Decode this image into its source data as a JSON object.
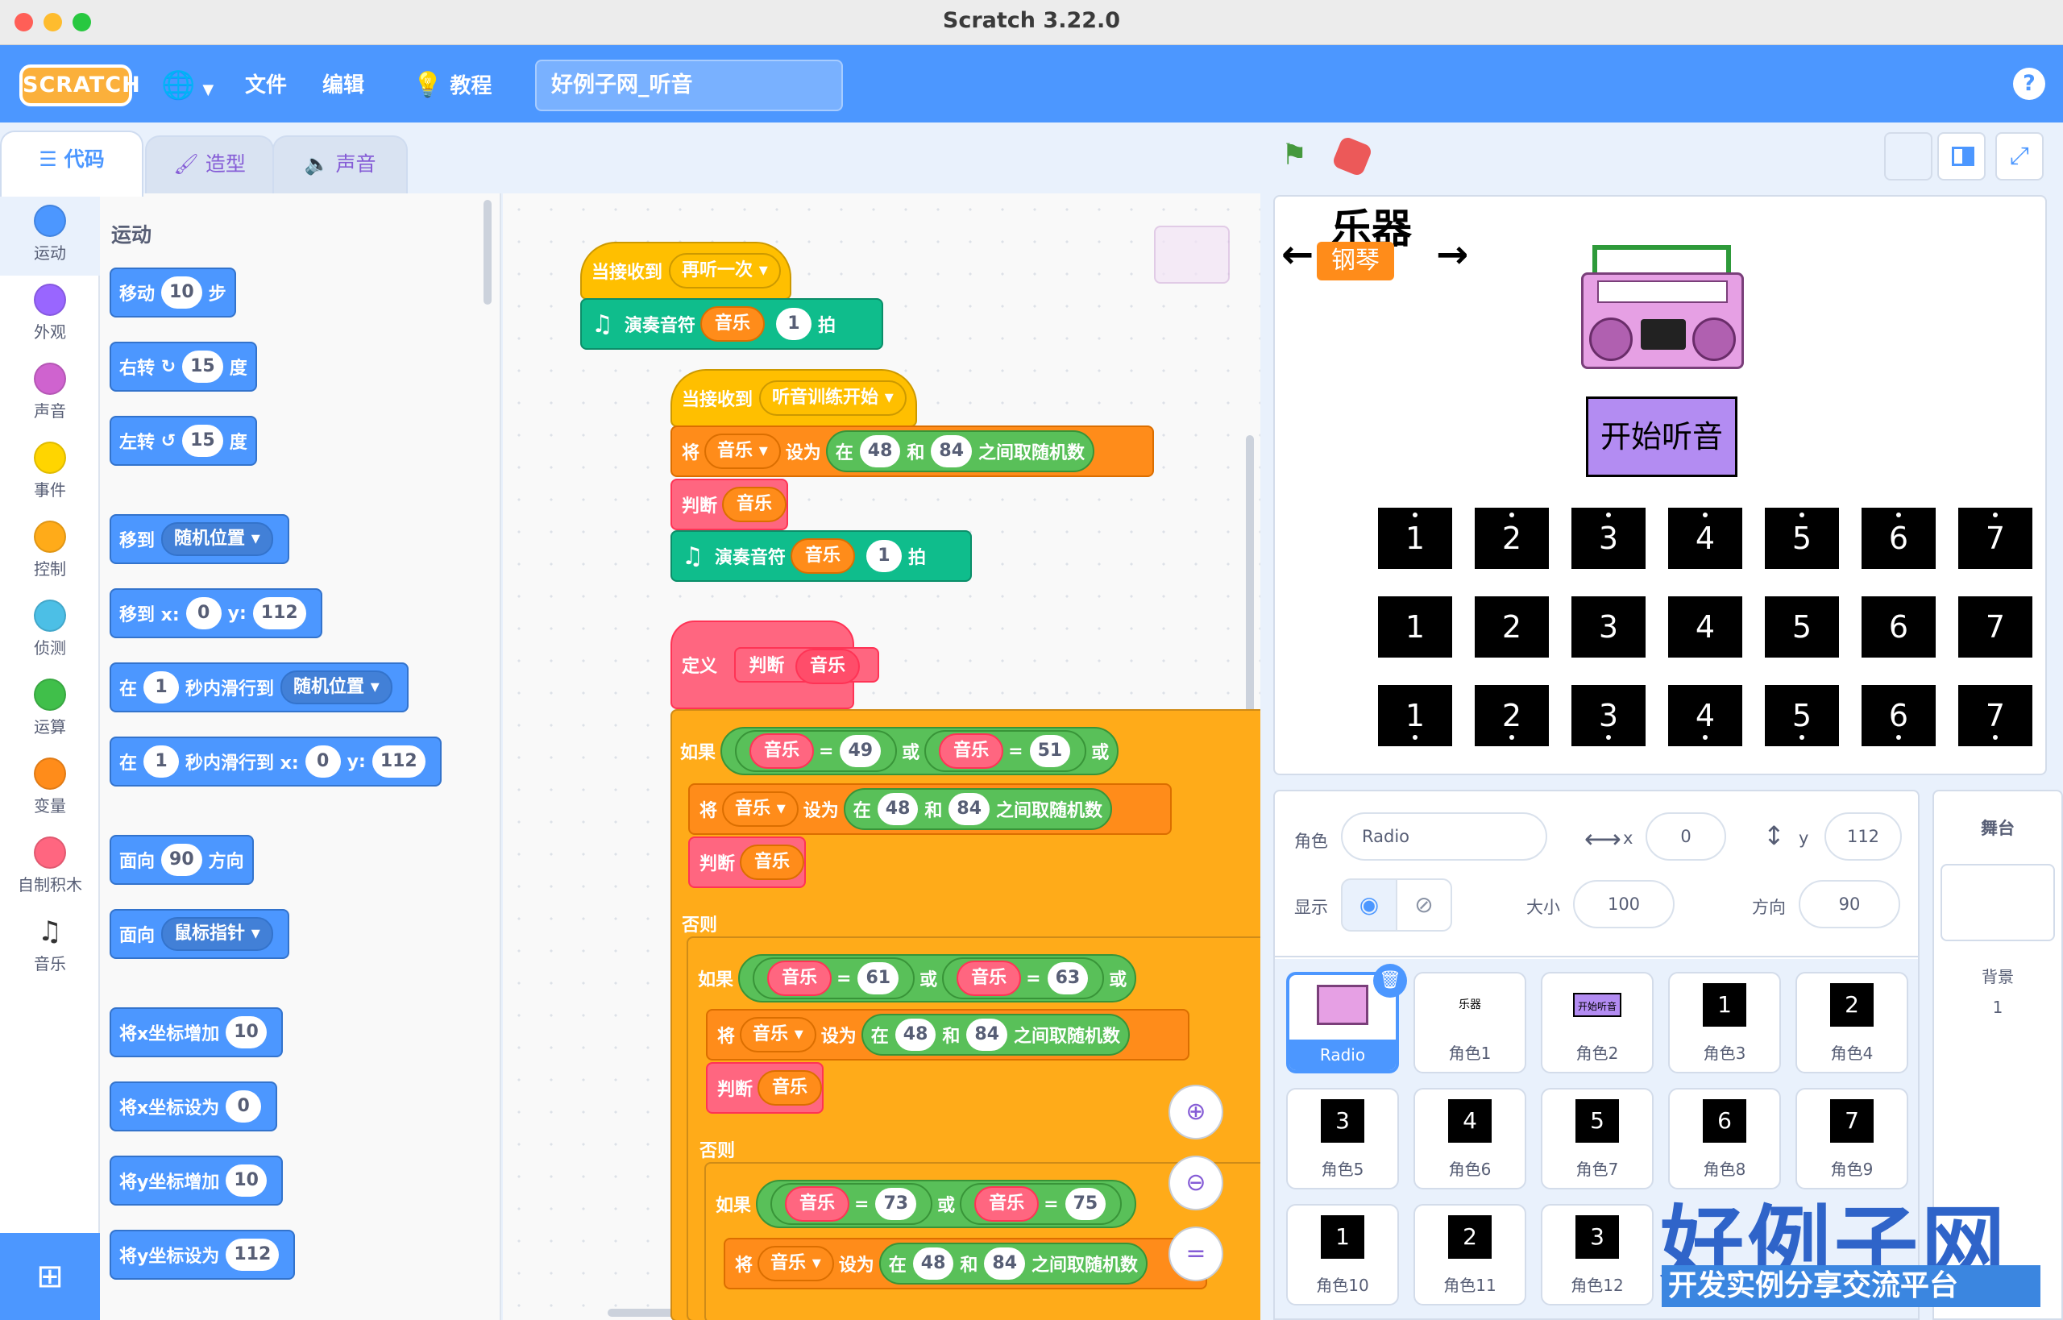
{
  "window": {
    "title": "Scratch 3.22.0"
  },
  "menu": {
    "logo": "SCRATCH",
    "file": "文件",
    "edit": "编辑",
    "tutorials": "教程",
    "project_title": "好例子网_听音",
    "help": "?"
  },
  "tabs": {
    "code": "代码",
    "costumes": "造型",
    "sounds": "声音"
  },
  "categories": [
    {
      "label": "运动",
      "color": "#4c97ff"
    },
    {
      "label": "外观",
      "color": "#9966ff"
    },
    {
      "label": "声音",
      "color": "#cf63cf"
    },
    {
      "label": "事件",
      "color": "#ffd500"
    },
    {
      "label": "控制",
      "color": "#ffab19"
    },
    {
      "label": "侦测",
      "color": "#4cbfe6"
    },
    {
      "label": "运算",
      "color": "#40bf4a"
    },
    {
      "label": "变量",
      "color": "#ff8c1a"
    },
    {
      "label": "自制积木",
      "color": "#ff6680"
    },
    {
      "label": "音乐",
      "color": "#0fbd8c"
    }
  ],
  "palette": {
    "title": "运动",
    "move": {
      "a": "移动",
      "n": "10",
      "b": "步"
    },
    "turn_right": {
      "a": "右转",
      "n": "15",
      "b": "度"
    },
    "turn_left": {
      "a": "左转",
      "n": "15",
      "b": "度"
    },
    "goto": {
      "a": "移到",
      "d": "随机位置"
    },
    "goto_xy": {
      "a": "移到 x:",
      "x": "0",
      "y_lbl": "y:",
      "y": "112"
    },
    "glide": {
      "a": "在",
      "n": "1",
      "b": "秒内滑行到",
      "d": "随机位置"
    },
    "glide_xy": {
      "a": "在",
      "n": "1",
      "b": "秒内滑行到 x:",
      "x": "0",
      "y_lbl": "y:",
      "y": "112"
    },
    "point_dir": {
      "a": "面向",
      "n": "90",
      "b": "方向"
    },
    "point_towards": {
      "a": "面向",
      "d": "鼠标指针"
    },
    "change_x": {
      "a": "将x坐标增加",
      "n": "10"
    },
    "set_x": {
      "a": "将x坐标设为",
      "n": "0"
    },
    "change_y": {
      "a": "将y坐标增加",
      "n": "10"
    },
    "set_y": {
      "a": "将y坐标设为",
      "n": "112"
    }
  },
  "script": {
    "when_recv1": "当接收到",
    "msg1": "再听一次",
    "play": "演奏音符",
    "var": "音乐",
    "beats": "1",
    "beat_unit": "拍",
    "when_recv2": "当接收到",
    "msg2": "听音训练开始",
    "set": "将",
    "set_to": "设为",
    "rand_in": "在",
    "rand_and": "和",
    "rand_end": "之间取随机数",
    "lo": "48",
    "hi": "84",
    "judge": "判断",
    "define": "定义",
    "if": "如果",
    "else": "否则",
    "or": "或",
    "eq": "=",
    "v49": "49",
    "v51": "51",
    "v61": "61",
    "v63": "63",
    "v73": "73",
    "v75": "75"
  },
  "stage": {
    "title": "乐器",
    "instrument": "钢琴",
    "left_arrow": "←",
    "right_arrow": "→",
    "start_button": "开始听音",
    "rows": [
      [
        "1",
        "2",
        "3",
        "4",
        "5",
        "6",
        "7"
      ],
      [
        "1",
        "2",
        "3",
        "4",
        "5",
        "6",
        "7"
      ],
      [
        "1",
        "2",
        "3",
        "4",
        "5",
        "6",
        "7"
      ]
    ],
    "row_marks": [
      "·above",
      "",
      "·below"
    ]
  },
  "sprite_info": {
    "sprite_lbl": "角色",
    "sprite_name": "Radio",
    "x_lbl": "x",
    "x": "0",
    "y_lbl": "y",
    "y": "112",
    "show_lbl": "显示",
    "size_lbl": "大小",
    "size": "100",
    "dir_lbl": "方向",
    "dir": "90"
  },
  "sprites": [
    {
      "name": "Radio",
      "thumb": ""
    },
    {
      "name": "角色1",
      "thumb": "乐器"
    },
    {
      "name": "角色2",
      "thumb": "开始听音"
    },
    {
      "name": "角色3",
      "thumb": "1"
    },
    {
      "name": "角色4",
      "thumb": "2"
    },
    {
      "name": "角色5",
      "thumb": "3"
    },
    {
      "name": "角色6",
      "thumb": "4"
    },
    {
      "name": "角色7",
      "thumb": "5"
    },
    {
      "name": "角色8",
      "thumb": "6"
    },
    {
      "name": "角色9",
      "thumb": "7"
    },
    {
      "name": "角色10",
      "thumb": "1"
    },
    {
      "name": "角色11",
      "thumb": "2"
    },
    {
      "name": "角色12",
      "thumb": "3"
    }
  ],
  "stage_panel": {
    "title": "舞台",
    "backdrops_lbl": "背景",
    "backdrops": "1"
  },
  "watermark": {
    "big": "好例子网",
    "small": "开发实例分享交流平台"
  }
}
